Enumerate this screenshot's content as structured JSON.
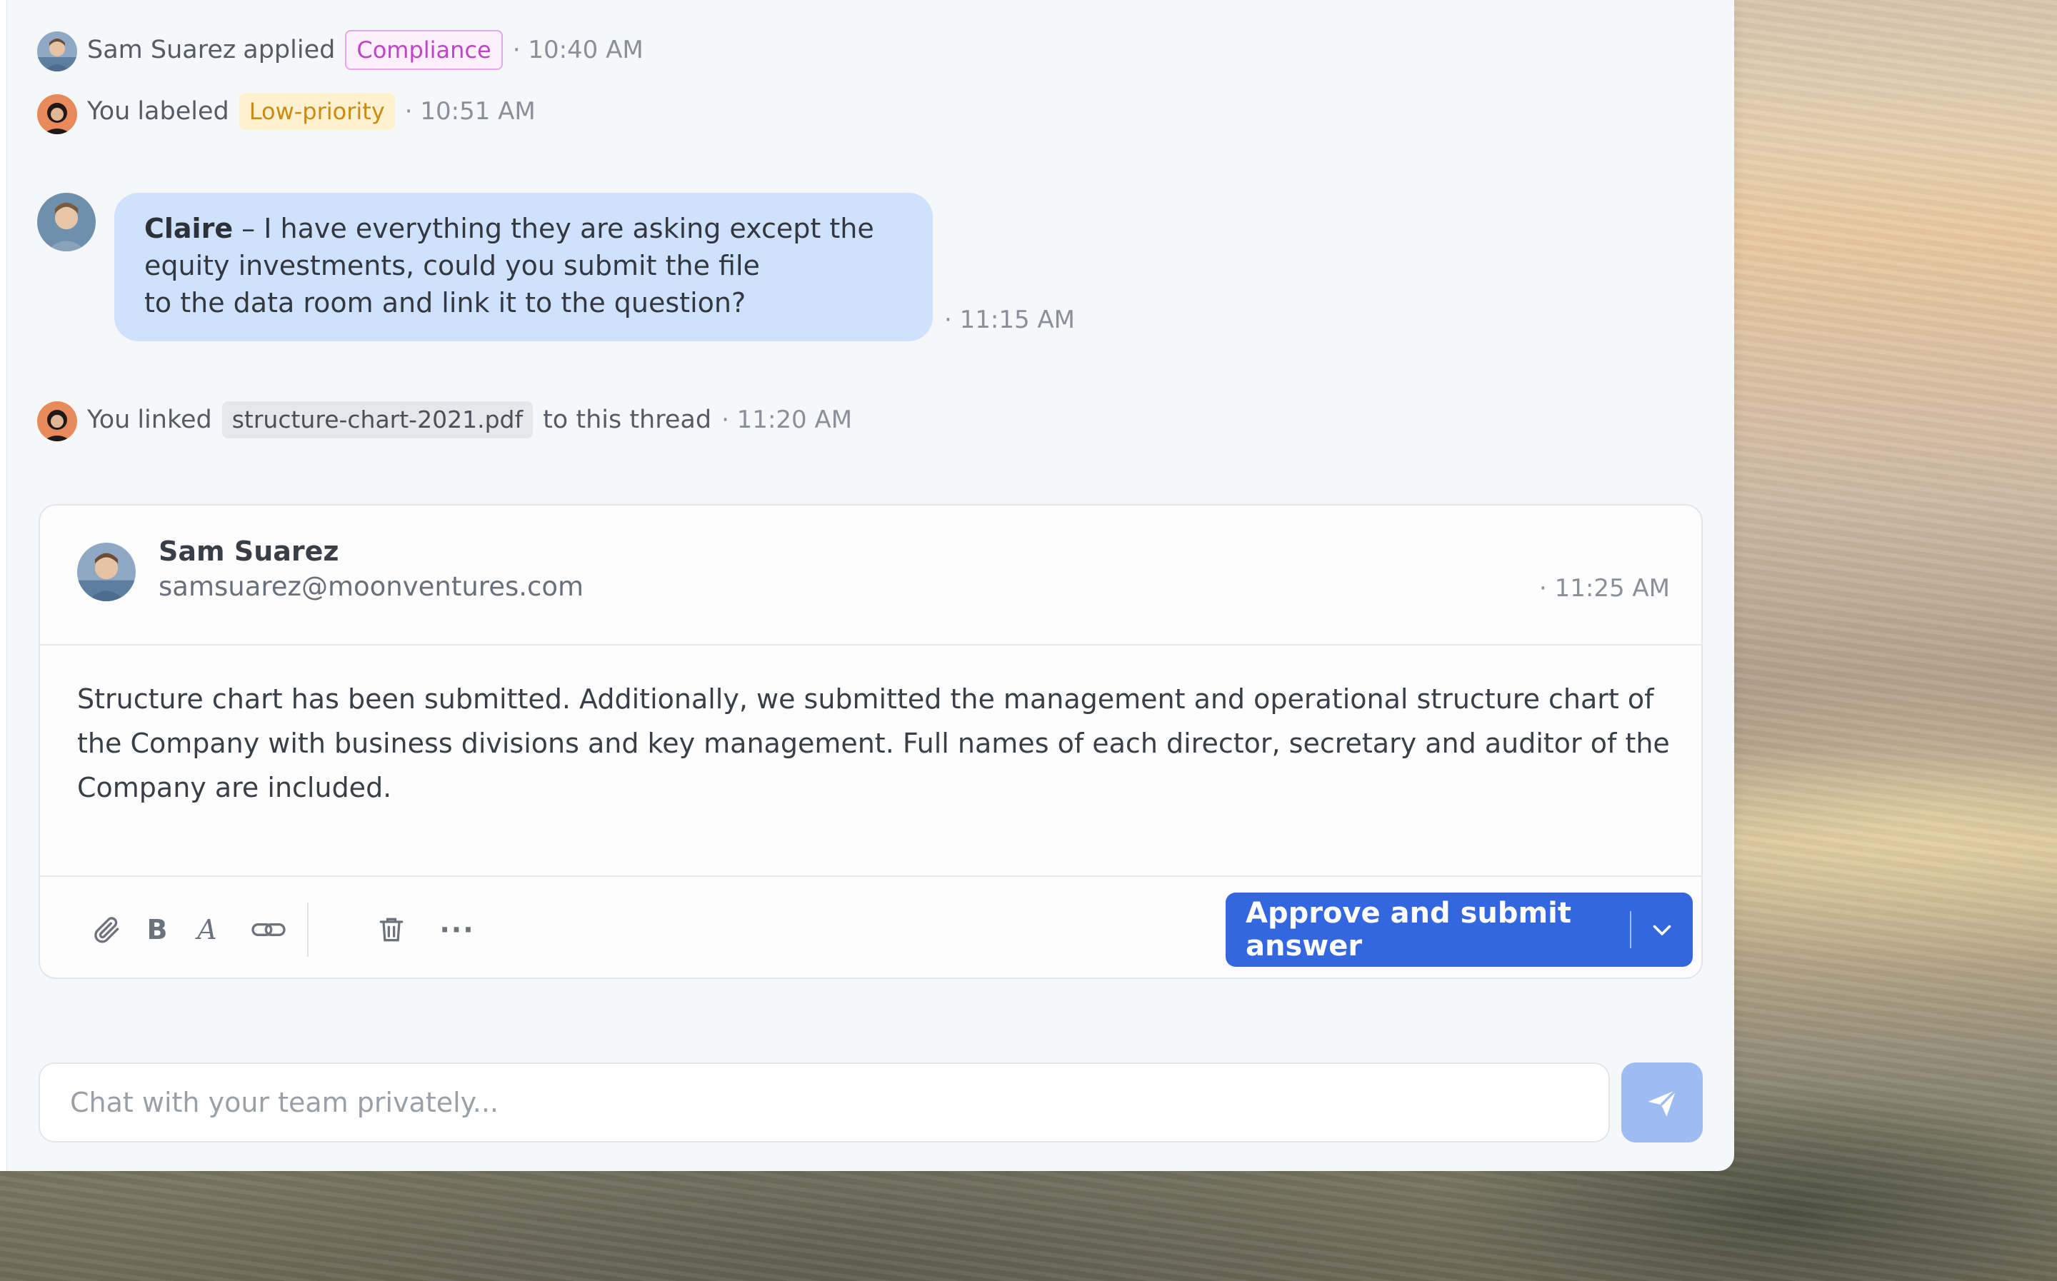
{
  "activity": [
    {
      "actor": "Sam Suarez",
      "verb": "applied",
      "tag": "Compliance",
      "time": "· 10:40 AM"
    },
    {
      "actor": "You",
      "verb": "labeled",
      "tag": "Low-priority",
      "time": "· 10:51 AM"
    },
    {
      "actor": "You",
      "verb": "linked",
      "file": "structure-chart-2021.pdf",
      "suffix": "to this thread",
      "time": "· 11:20 AM"
    }
  ],
  "message": {
    "author": "Claire",
    "line1": " – I have everything they are asking except the",
    "line2": "equity investments, could you submit the file",
    "line3": "to the data room and link it to the question?",
    "time": "· 11:15 AM"
  },
  "answer": {
    "name": "Sam Suarez",
    "email": "samsuarez@moonventures.com",
    "time": "· 11:25 AM",
    "body": "Structure chart has been submitted. Additionally, we submitted the management and operational structure chart of the Company with business divisions and key management. Full names of each director, secretary and auditor of the Company are included.",
    "toolbar": {
      "attach_icon": "paperclip-icon",
      "bold_label": "B",
      "italic_label": "A",
      "link_icon": "link-icon",
      "delete_icon": "trash-icon",
      "more_label": "···"
    },
    "approve_label": "Approve and submit answer"
  },
  "chat": {
    "placeholder": "Chat with your team privately..."
  },
  "colors": {
    "accent": "#3466e0",
    "bubble": "#cfe2fd",
    "compliance": "#c044c8",
    "low_priority": "#cc8a10"
  }
}
